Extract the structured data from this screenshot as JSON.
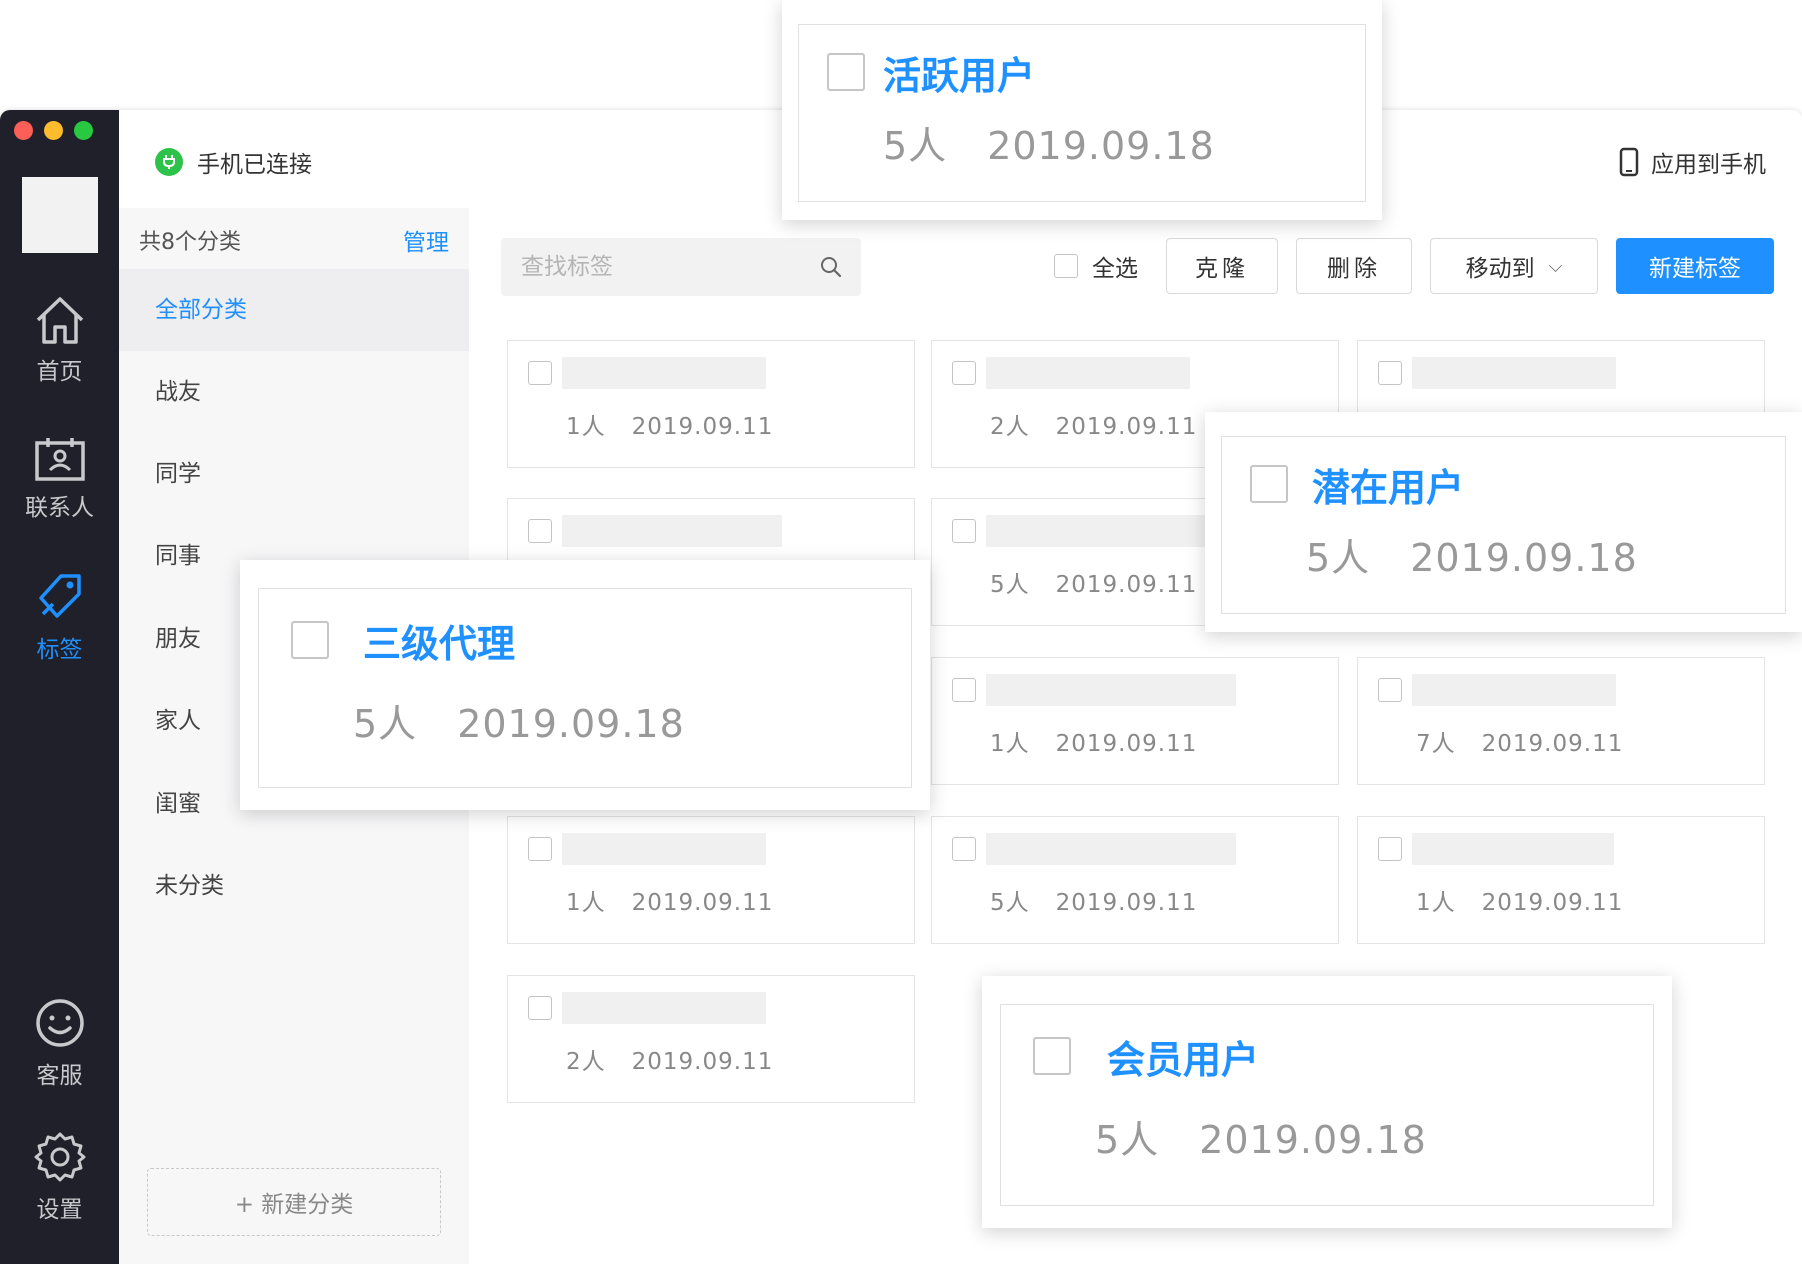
{
  "nav": {
    "items": [
      {
        "label": "首页",
        "icon": "home-icon"
      },
      {
        "label": "联系人",
        "icon": "contacts-icon"
      },
      {
        "label": "标签",
        "icon": "tag-icon"
      },
      {
        "label": "客服",
        "icon": "smile-icon"
      },
      {
        "label": "设置",
        "icon": "gear-icon"
      }
    ],
    "active": "标签"
  },
  "header": {
    "status": "手机已连接",
    "apply": "应用到手机"
  },
  "sidebar": {
    "count_label": "共8个分类",
    "manage": "管理",
    "categories": [
      "全部分类",
      "战友",
      "同学",
      "同事",
      "朋友",
      "家人",
      "闺蜜",
      "未分类"
    ],
    "new_category": "+ 新建分类"
  },
  "toolbar": {
    "search_placeholder": "查找标签",
    "select_all": "全选",
    "clone": "克隆",
    "delete": "删除",
    "move_to": "移动到",
    "new_tag": "新建标签"
  },
  "cards": [
    {
      "count": "1人",
      "date": "2019.09.11"
    },
    {
      "count": "2人",
      "date": "2019.09.11"
    },
    {
      "count": "",
      "date": ""
    },
    {
      "count": "",
      "date": ""
    },
    {
      "count": "5人",
      "date": "2019.09.11"
    },
    {
      "count": "",
      "date": ""
    },
    {
      "count": "",
      "date": ""
    },
    {
      "count": "1人",
      "date": "2019.09.11"
    },
    {
      "count": "7人",
      "date": "2019.09.11"
    },
    {
      "count": "1人",
      "date": "2019.09.11"
    },
    {
      "count": "5人",
      "date": "2019.09.11"
    },
    {
      "count": "1人",
      "date": "2019.09.11"
    },
    {
      "count": "2人",
      "date": "2019.09.11"
    }
  ],
  "popups": [
    {
      "title": "活跃用户",
      "count": "5人",
      "date": "2019.09.18"
    },
    {
      "title": "潜在用户",
      "count": "5人",
      "date": "2019.09.18"
    },
    {
      "title": "三级代理",
      "count": "5人",
      "date": "2019.09.18"
    },
    {
      "title": "会员用户",
      "count": "5人",
      "date": "2019.09.18"
    }
  ],
  "colors": {
    "accent": "#1e90ff",
    "nav_bg": "#1f2029",
    "connected": "#2dc34a"
  }
}
